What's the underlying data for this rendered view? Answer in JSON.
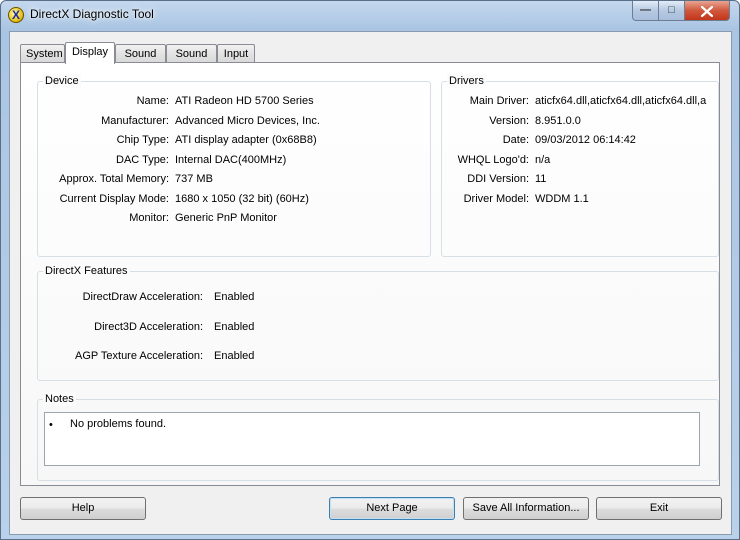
{
  "window": {
    "title": "DirectX Diagnostic Tool",
    "min_glyph": "—",
    "max_glyph": "□"
  },
  "tabs": [
    {
      "label": "System",
      "active": false
    },
    {
      "label": "Display",
      "active": true
    },
    {
      "label": "Sound 1",
      "active": false
    },
    {
      "label": "Sound 2",
      "active": false
    },
    {
      "label": "Input",
      "active": false
    }
  ],
  "device": {
    "title": "Device",
    "rows": [
      {
        "label": "Name:",
        "value": "ATI Radeon HD 5700 Series"
      },
      {
        "label": "Manufacturer:",
        "value": "Advanced Micro Devices, Inc."
      },
      {
        "label": "Chip Type:",
        "value": "ATI display adapter (0x68B8)"
      },
      {
        "label": "DAC Type:",
        "value": "Internal DAC(400MHz)"
      },
      {
        "label": "Approx. Total Memory:",
        "value": "737 MB"
      },
      {
        "label": "Current Display Mode:",
        "value": "1680 x 1050 (32 bit) (60Hz)"
      },
      {
        "label": "Monitor:",
        "value": "Generic PnP Monitor"
      }
    ]
  },
  "drivers": {
    "title": "Drivers",
    "rows": [
      {
        "label": "Main Driver:",
        "value": "aticfx64.dll,aticfx64.dll,aticfx64.dll,a"
      },
      {
        "label": "Version:",
        "value": "8.951.0.0"
      },
      {
        "label": "Date:",
        "value": "09/03/2012 06:14:42"
      },
      {
        "label": "WHQL Logo'd:",
        "value": "n/a"
      },
      {
        "label": "DDI Version:",
        "value": "11"
      },
      {
        "label": "Driver Model:",
        "value": "WDDM 1.1"
      }
    ]
  },
  "features": {
    "title": "DirectX Features",
    "rows": [
      {
        "label": "DirectDraw Acceleration:",
        "value": "Enabled"
      },
      {
        "label": "Direct3D Acceleration:",
        "value": "Enabled"
      },
      {
        "label": "AGP Texture Acceleration:",
        "value": "Enabled"
      }
    ]
  },
  "notes": {
    "title": "Notes",
    "bullet": "•",
    "text": "No problems found."
  },
  "buttons": {
    "help": "Help",
    "next_page": "Next Page",
    "save_all": "Save All Information...",
    "exit": "Exit"
  }
}
